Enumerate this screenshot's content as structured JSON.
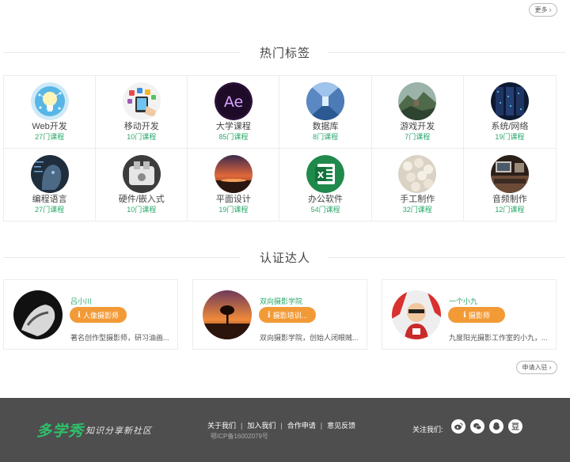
{
  "top": {
    "more_label": "更多 ›"
  },
  "hot_tags": {
    "title": "热门标签",
    "items": [
      {
        "name": "Web开发",
        "count": "27门课程",
        "icon": "lightbulb-web-icon"
      },
      {
        "name": "移动开发",
        "count": "10门课程",
        "icon": "mobile-apps-icon"
      },
      {
        "name": "大学课程",
        "count": "85门课程",
        "icon": "after-effects-icon"
      },
      {
        "name": "数据库",
        "count": "8门课程",
        "icon": "database-corridor-icon"
      },
      {
        "name": "游戏开发",
        "count": "7门课程",
        "icon": "game-landscape-icon"
      },
      {
        "name": "系统/网络",
        "count": "19门课程",
        "icon": "server-room-icon"
      },
      {
        "name": "编程语言",
        "count": "27门课程",
        "icon": "programming-face-icon"
      },
      {
        "name": "硬件/嵌入式",
        "count": "10门课程",
        "icon": "hardware-icon"
      },
      {
        "name": "平面设计",
        "count": "19门课程",
        "icon": "sunset-design-icon"
      },
      {
        "name": "办公软件",
        "count": "54门课程",
        "icon": "excel-icon"
      },
      {
        "name": "手工制作",
        "count": "32门课程",
        "icon": "handcraft-icon"
      },
      {
        "name": "音频制作",
        "count": "12门课程",
        "icon": "audio-mixer-icon"
      }
    ]
  },
  "experts": {
    "title": "认证达人",
    "items": [
      {
        "name": "吕小川",
        "badge": "人像摄影师",
        "desc": "著名创作型摄影师，研习油画..."
      },
      {
        "name": "双向摄影学院",
        "badge": "摄影培训...",
        "desc": "双向摄影学院，创始人闭眼贼..."
      },
      {
        "name": "一个小九",
        "badge": "摄影师",
        "desc": "九度阳光摄影工作室的小九，..."
      }
    ],
    "apply_label": "申请入驻 ›"
  },
  "footer": {
    "logo": "多学秀",
    "slogan": "知识分享新社区",
    "links": [
      "关于我们",
      "加入我们",
      "合作申请",
      "意见反馈"
    ],
    "icp": "鄂ICP备16002079号",
    "follow_label": "关注我们:",
    "social_icons": [
      "weibo-icon",
      "wechat-icon",
      "qq-icon",
      "douban-icon"
    ]
  },
  "colors": {
    "accent_green": "#2aa86a",
    "badge_orange": "#f29a36",
    "footer_bg": "#4e4e4e"
  }
}
